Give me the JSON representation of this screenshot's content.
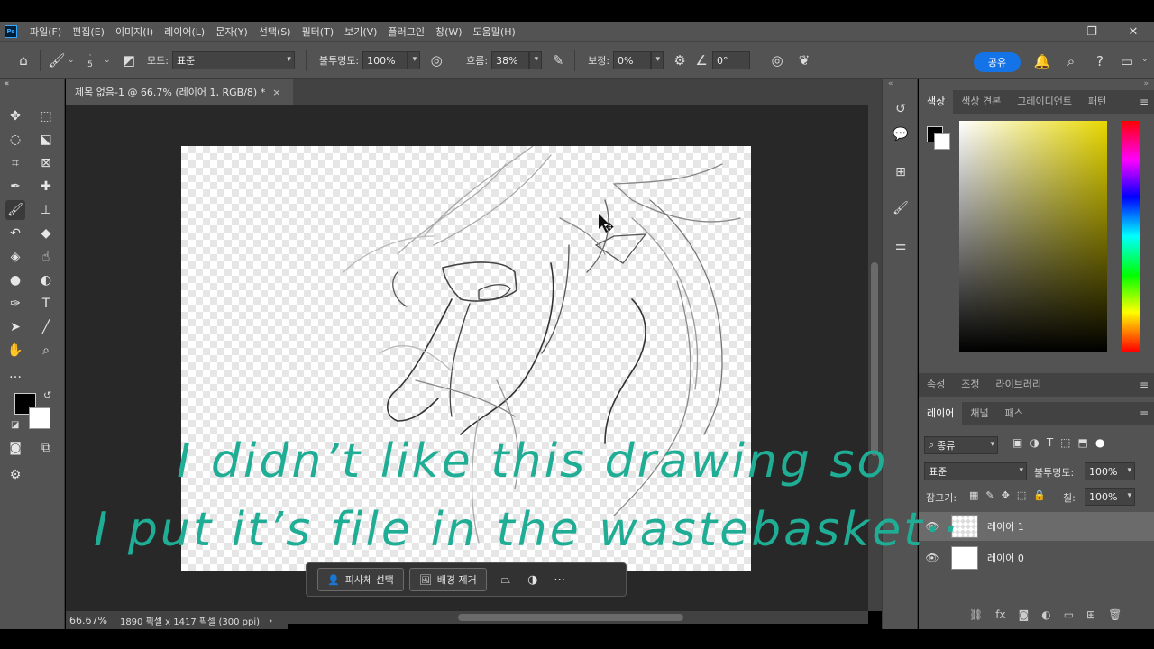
{
  "app": {
    "logo": "Ps"
  },
  "menu": [
    "파일(F)",
    "편집(E)",
    "이미지(I)",
    "레이어(L)",
    "문자(Y)",
    "선택(S)",
    "필터(T)",
    "보기(V)",
    "플러그인",
    "창(W)",
    "도움말(H)"
  ],
  "window_controls": {
    "minimize": "—",
    "restore": "❐",
    "close": "✕"
  },
  "options": {
    "brush_size": "5",
    "mode_label": "모드:",
    "mode_value": "표준",
    "opacity_label": "불투명도:",
    "opacity_value": "100%",
    "flow_label": "흐름:",
    "flow_value": "38%",
    "smoothing_label": "보정:",
    "smoothing_value": "0%",
    "angle_value": "0°",
    "share_label": "공유"
  },
  "document": {
    "tab_title": "제목 없음-1 @ 66.7% (레이어 1, RGB/8) *",
    "tab_close": "×",
    "zoom": "66.67%",
    "info": "1890 픽셀 x 1417 픽셀 (300 ppi)"
  },
  "context_bar": {
    "select_subject": "피사체 선택",
    "remove_background": "배경 제거"
  },
  "color_panel": {
    "tabs": [
      "색상",
      "색상 견본",
      "그레이디언트",
      "패턴"
    ]
  },
  "props_panel": {
    "tabs": [
      "속성",
      "조정",
      "라이브러리"
    ]
  },
  "layers_panel": {
    "tabs": [
      "레이어",
      "채널",
      "패스"
    ],
    "filter_label": "종류",
    "blend_mode": "표준",
    "opacity_label": "불투명도:",
    "opacity_value": "100%",
    "lock_label": "잠그기:",
    "fill_label": "칠:",
    "fill_value": "100%",
    "layers": [
      {
        "name": "레이어 1",
        "selected": true
      },
      {
        "name": "레이어 0",
        "selected": false
      }
    ]
  },
  "overlay": {
    "line1": "I didn’t like this drawing so",
    "line2": "I put it’s file in the wastebasket··"
  },
  "colors": {
    "accent": "#1473e6",
    "overlay_text": "#1fae95",
    "panel": "#535353"
  }
}
